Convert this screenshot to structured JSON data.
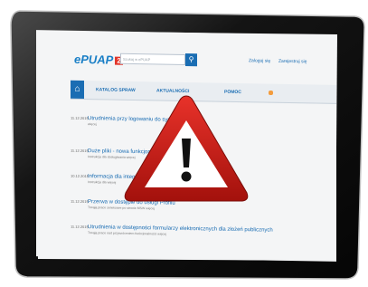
{
  "brand": {
    "name": "ePUAP",
    "mark": "2"
  },
  "header": {
    "search_placeholder": "Szukaj w ePUAP",
    "login": "Zaloguj się",
    "register": "Zarejestruj się"
  },
  "nav": {
    "tabs": [
      "KATALOG SPRAW",
      "AKTUALNOŚCI",
      "POMOC"
    ]
  },
  "news": [
    {
      "date": "11.12.2015",
      "title": "Utrudnienia przy logowaniu do systemu",
      "sub": "więcej"
    },
    {
      "date": "11.12.2015",
      "title": "Duże pliki - nowa funkcjonalność",
      "sub": "Instrukcja dla obsługiwania więcej"
    },
    {
      "date": "10.12.2015",
      "title": "Informacja dla integratorów",
      "sub": "Instrukcja dla więcej"
    },
    {
      "date": "11.12.2015",
      "title": "Przerwa w dostępie do usługi Profilu",
      "sub": "Trwają prace serwisowe po stronie MSW więcej"
    },
    {
      "date": "11.12.2015",
      "title": "Utrudnienia w dostępności formularzy elektronicznych dla złożeń publicznych",
      "sub": "Trwają prace nad przywróceniem funkcjonalności więcej"
    }
  ],
  "icons": {
    "warning": "warning-triangle-icon",
    "home": "home-icon",
    "search": "search-icon"
  }
}
